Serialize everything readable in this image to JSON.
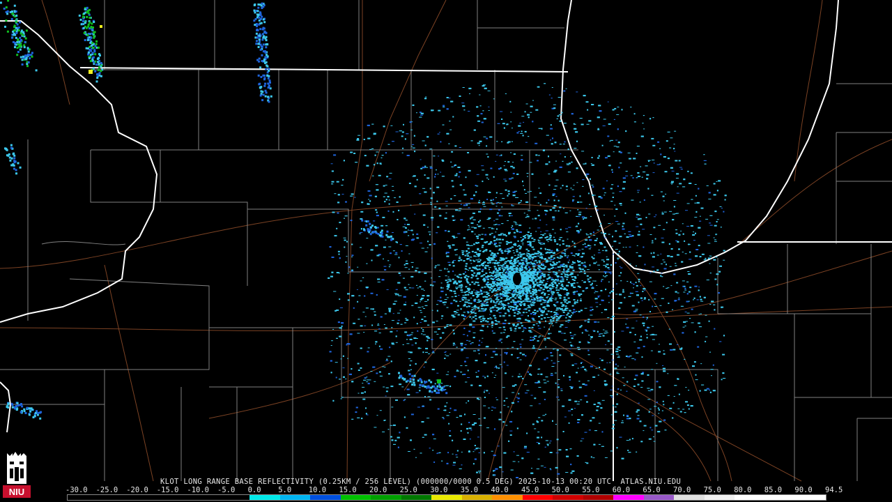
{
  "caption": "KLOT LONG RANGE BASE REFLECTIVITY (0.25KM / 256 LEVEL) (000000/0000 0.5 DEG) 2025-10-13 00:20 UTC  ATLAS.NIU.EDU",
  "logo_text": "NIU",
  "scale": {
    "labels": [
      "-30.0",
      "-25.0",
      "-20.0",
      "-15.0",
      "-10.0",
      "-5.0",
      "0.0",
      "5.0",
      "10.0",
      "15.0",
      "20.0",
      "25.0",
      "30.0",
      "35.0",
      "40.0",
      "45.0",
      "50.0",
      "55.0",
      "60.0",
      "65.0",
      "70.0",
      "75.0",
      "80.0",
      "85.0",
      "90.0",
      "94.5"
    ],
    "colors": [
      "#000000",
      "#000000",
      "#000000",
      "#000000",
      "#000000",
      "#000000",
      "#00e8e8",
      "#00b4f0",
      "#0050e0",
      "#00c000",
      "#00a000",
      "#007800",
      "#e8e800",
      "#d8b000",
      "#ff9000",
      "#ff0000",
      "#d00000",
      "#b00000",
      "#ff00ff",
      "#9858c8",
      "#e0e0e0",
      "#f0f0f0",
      "#ffffff",
      "#ffffff",
      "#ffffff"
    ]
  },
  "map_colors": {
    "state_border": "#ffffff",
    "county_line": "#9a9a9a",
    "road": "#8a4a28",
    "echo_light": "#3cc8ec",
    "echo_mid": "#1e64dc",
    "echo_green": "#10c020",
    "echo_yellow": "#f0f020"
  }
}
